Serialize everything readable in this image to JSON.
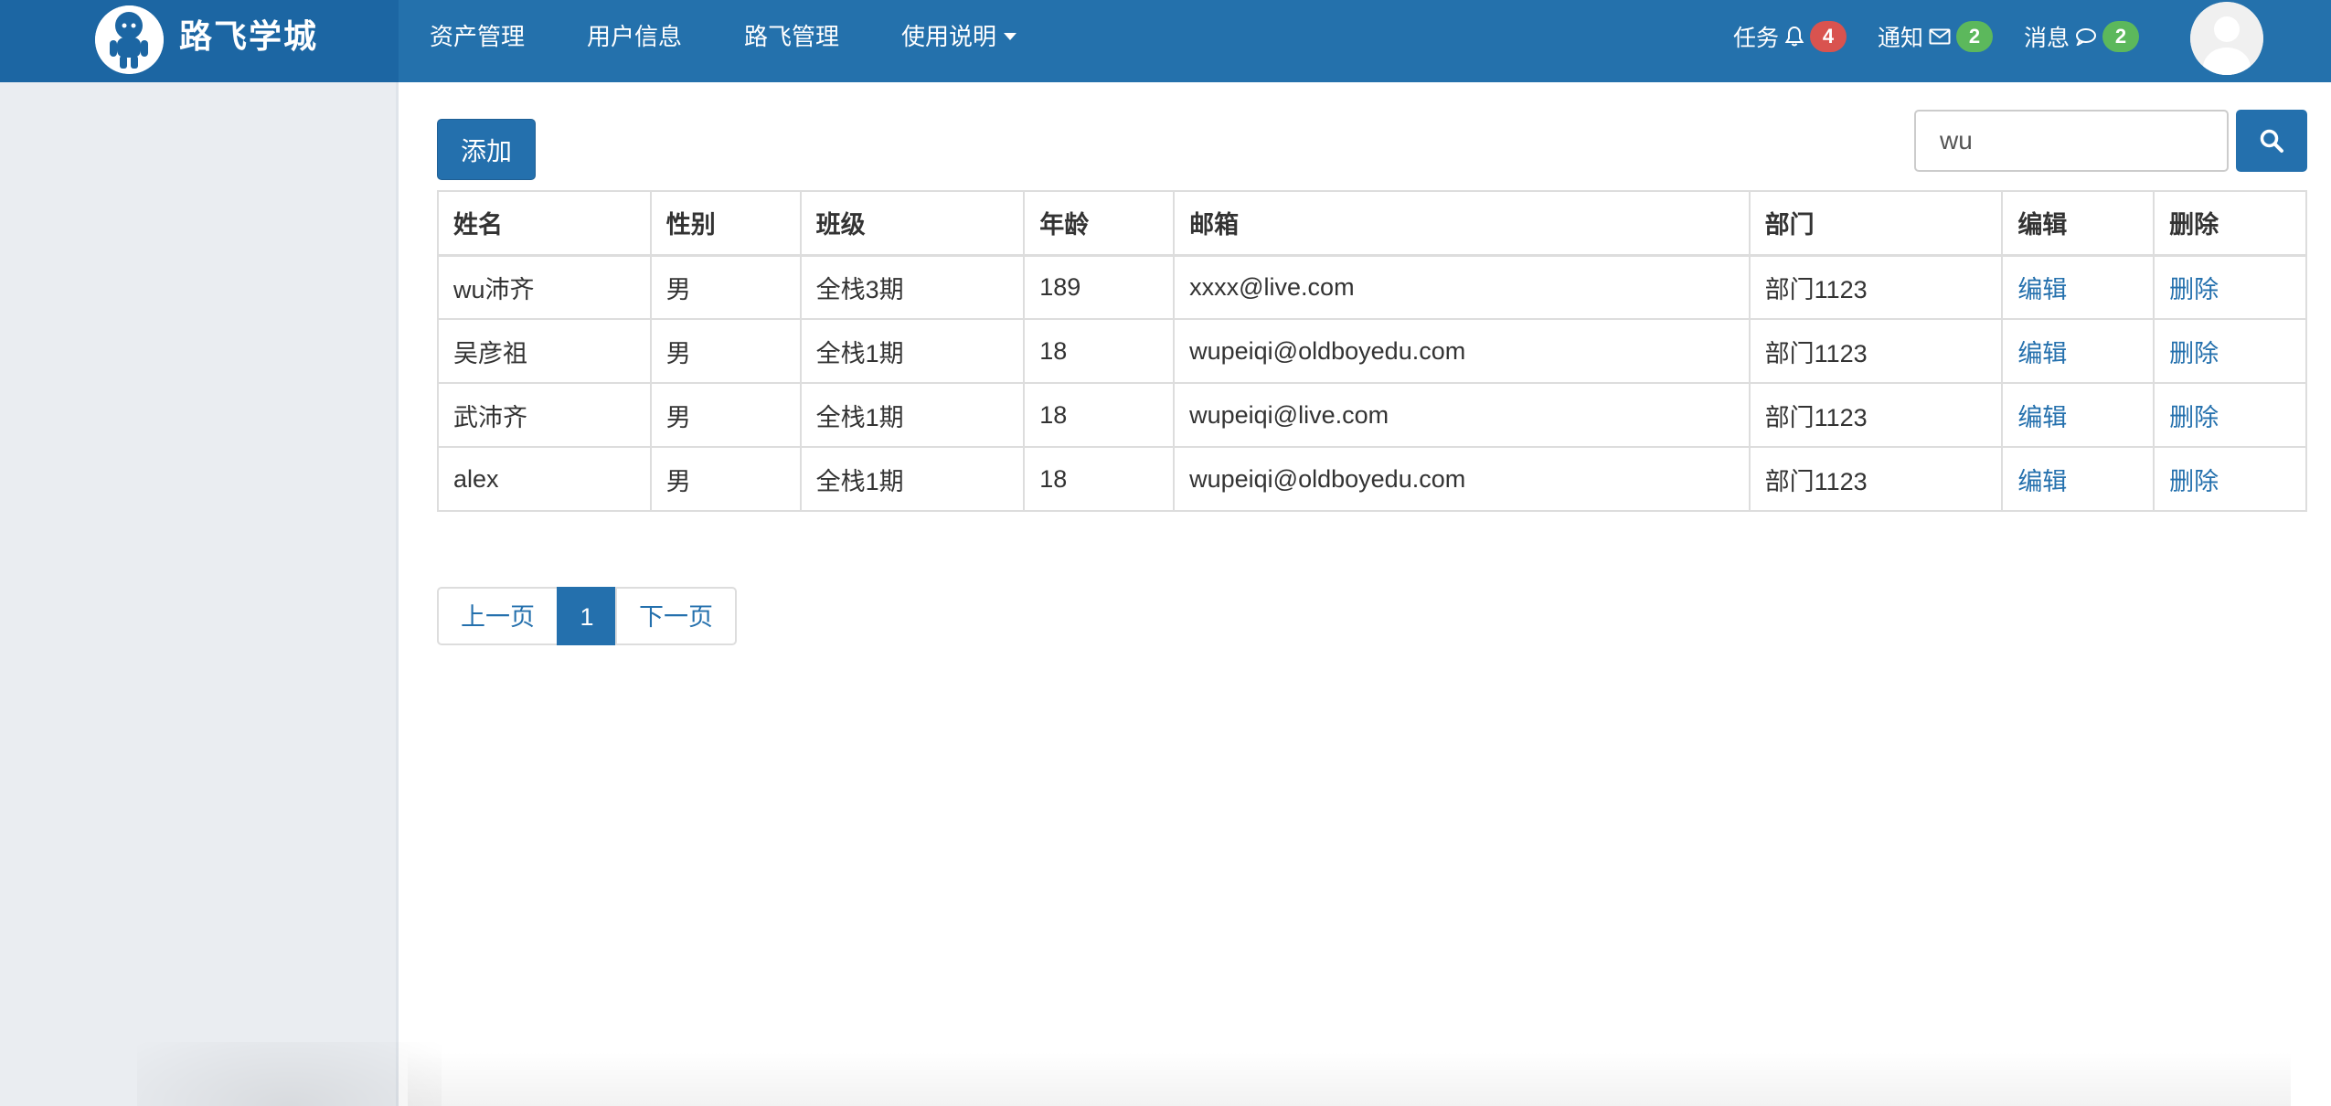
{
  "brand": {
    "title": "路飞学城",
    "logo_icon": "mascot-logo-icon"
  },
  "nav": {
    "items": [
      {
        "label": "资产管理"
      },
      {
        "label": "用户信息"
      },
      {
        "label": "路飞管理"
      },
      {
        "label": "使用说明",
        "has_caret": true
      }
    ]
  },
  "header_right": {
    "tasks": {
      "label": "任务",
      "icon": "bell-icon",
      "count": "4",
      "badge_color": "#d9534f"
    },
    "notices": {
      "label": "通知",
      "icon": "envelope-icon",
      "count": "2",
      "badge_color": "#5cb85c"
    },
    "messages": {
      "label": "消息",
      "icon": "comment-icon",
      "count": "2",
      "badge_color": "#5cb85c"
    },
    "avatar_icon": "user-avatar-icon"
  },
  "toolbar": {
    "add_label": "添加",
    "search_value": "wu",
    "search_icon": "search-icon"
  },
  "table": {
    "headers": [
      "姓名",
      "性别",
      "班级",
      "年龄",
      "邮箱",
      "部门",
      "编辑",
      "删除"
    ],
    "rows": [
      {
        "name": "wu沛齐",
        "gender": "男",
        "class": "全栈3期",
        "age": "189",
        "email": "xxxx@live.com",
        "dept": "部门1123",
        "edit": "编辑",
        "delete": "删除"
      },
      {
        "name": "吴彦祖",
        "gender": "男",
        "class": "全栈1期",
        "age": "18",
        "email": "wupeiqi@oldboyedu.com",
        "dept": "部门1123",
        "edit": "编辑",
        "delete": "删除"
      },
      {
        "name": "武沛齐",
        "gender": "男",
        "class": "全栈1期",
        "age": "18",
        "email": "wupeiqi@live.com",
        "dept": "部门1123",
        "edit": "编辑",
        "delete": "删除"
      },
      {
        "name": "alex",
        "gender": "男",
        "class": "全栈1期",
        "age": "18",
        "email": "wupeiqi@oldboyedu.com",
        "dept": "部门1123",
        "edit": "编辑",
        "delete": "删除"
      }
    ]
  },
  "pagination": {
    "prev": "上一页",
    "current": "1",
    "next": "下一页"
  },
  "colors": {
    "topbar": "#2471ac",
    "brand_bg": "#1c66a3",
    "primary": "#2470ad",
    "sidebar": "#eaedf1"
  }
}
